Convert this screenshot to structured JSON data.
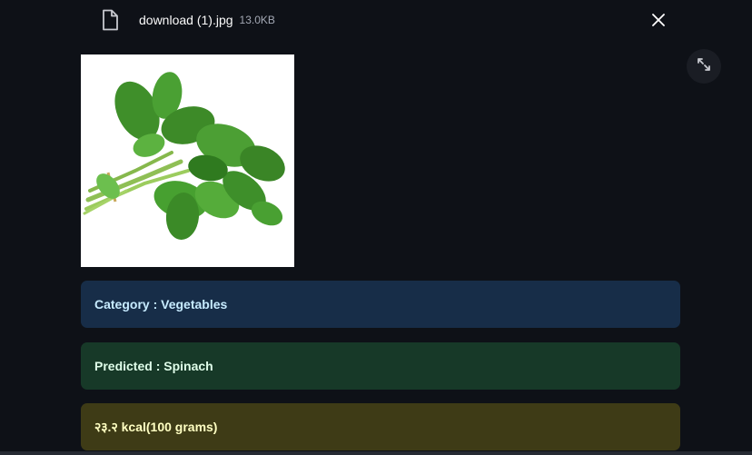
{
  "file": {
    "name": "download (1).jpg",
    "size": "13.0KB",
    "icon": "file-icon"
  },
  "controls": {
    "close_icon": "close-icon",
    "fullscreen_icon": "fullscreen-icon"
  },
  "image": {
    "subject": "spinach-bunch"
  },
  "results": {
    "category": "Category : Vegetables",
    "predicted": "Predicted : Spinach",
    "calories": "२३.२ kcal(100 grams)"
  },
  "colors": {
    "background": "#0e1117",
    "info_bg": "#172d48",
    "success_bg": "#173928",
    "warning_bg": "#3e3b16"
  }
}
